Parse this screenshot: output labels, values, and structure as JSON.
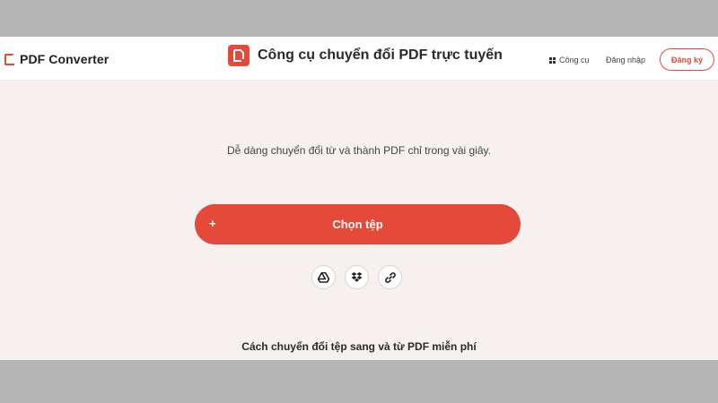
{
  "header": {
    "brand": "PDF Converter",
    "title": "Công cụ chuyển đổi PDF trực tuyến",
    "nav": {
      "tools": "Công cụ",
      "login": "Đăng nhập",
      "signup": "Đăng ký"
    }
  },
  "hero": {
    "subtitle": "Dễ dàng chuyển đổi từ và thành PDF chỉ trong vài giây.",
    "choose_plus": "+",
    "choose_label": "Chọn tệp",
    "sources": [
      "google-drive-icon",
      "dropbox-icon",
      "link-icon"
    ]
  },
  "section": {
    "howto_title": "Cách chuyển đổi tệp sang và từ PDF miễn phí"
  },
  "colors": {
    "accent": "#e5493a",
    "background": "#f6f1ef",
    "letterbox": "#b4b4b4"
  }
}
